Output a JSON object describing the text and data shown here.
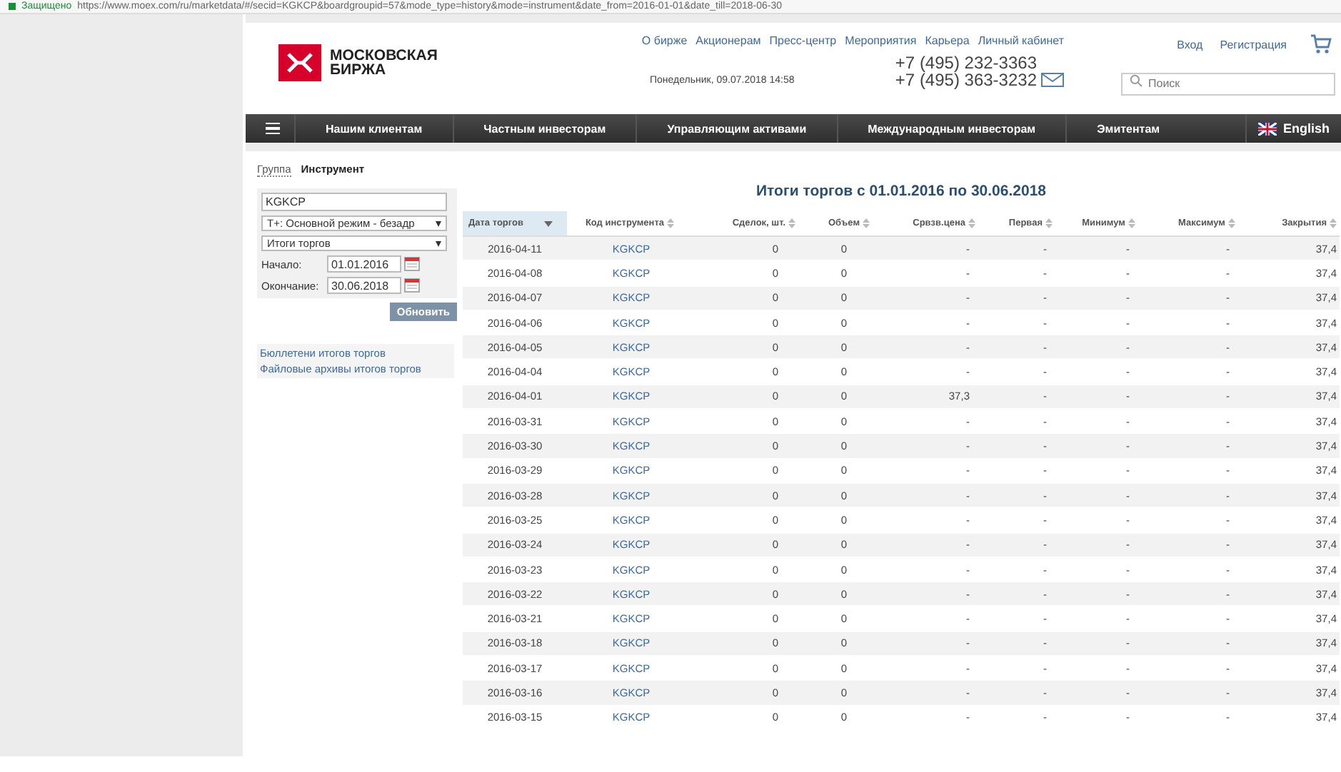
{
  "browser": {
    "secure_label": "Защищено",
    "url": "https://www.moex.com/ru/marketdata/#/secid=KGKCP&boardgroupid=57&mode_type=history&mode=instrument&date_from=2016-01-01&date_till=2018-06-30"
  },
  "header": {
    "logo_text": [
      "МОСКОВСКАЯ",
      "БИРЖА"
    ],
    "date": "Понедельник, 09.07.2018 14:58",
    "top_links": [
      "О бирже",
      "Акционерам",
      "Пресс-центр",
      "Мероприятия",
      "Карьера",
      "Личный кабинет"
    ],
    "phones": [
      "+7 (495) 232-3363",
      "+7 (495) 363-3232"
    ],
    "auth_links": [
      "Вход",
      "Регистрация"
    ],
    "search": {
      "placeholder": "Поиск"
    }
  },
  "nav": {
    "items": [
      "Нашим клиентам",
      "Частным инвесторам",
      "Управляющим активами",
      "Международным инвесторам",
      "Эмитентам"
    ],
    "language": "English"
  },
  "tabs": [
    {
      "label": "Группа",
      "selected": false
    },
    {
      "label": "Инструмент",
      "selected": true
    }
  ],
  "filters": {
    "instrument": "KGKCP",
    "board": "Т+: Основной режим - безадр",
    "report": "Итоги торгов",
    "start_label": "Начало:",
    "start": "01.01.2016",
    "end_label": "Окончание:",
    "end": "30.06.2018",
    "button": "Обновить"
  },
  "links": [
    "Бюллетени итогов торгов",
    "Файловые архивы итогов торгов"
  ],
  "table": {
    "title": "Итоги торгов с 01.01.2016 по 30.06.2018",
    "columns": [
      {
        "label": "Дата торгов",
        "sorted": true
      },
      {
        "label": "Код инструмента",
        "sorted": false
      },
      {
        "label": "Сделок, шт.",
        "sorted": false
      },
      {
        "label": "Объем",
        "sorted": false
      },
      {
        "label": "Срвзв.цена",
        "sorted": false
      },
      {
        "label": "Первая",
        "sorted": false
      },
      {
        "label": "Минимум",
        "sorted": false
      },
      {
        "label": "Максимум",
        "sorted": false
      },
      {
        "label": "Закрытия",
        "sorted": false
      }
    ],
    "rows": [
      [
        "2016-04-11",
        "KGKCP",
        "0",
        "0",
        "-",
        "-",
        "-",
        "-",
        "37,4"
      ],
      [
        "2016-04-08",
        "KGKCP",
        "0",
        "0",
        "-",
        "-",
        "-",
        "-",
        "37,4"
      ],
      [
        "2016-04-07",
        "KGKCP",
        "0",
        "0",
        "-",
        "-",
        "-",
        "-",
        "37,4"
      ],
      [
        "2016-04-06",
        "KGKCP",
        "0",
        "0",
        "-",
        "-",
        "-",
        "-",
        "37,4"
      ],
      [
        "2016-04-05",
        "KGKCP",
        "0",
        "0",
        "-",
        "-",
        "-",
        "-",
        "37,4"
      ],
      [
        "2016-04-04",
        "KGKCP",
        "0",
        "0",
        "-",
        "-",
        "-",
        "-",
        "37,4"
      ],
      [
        "2016-04-01",
        "KGKCP",
        "0",
        "0",
        "37,3",
        "-",
        "-",
        "-",
        "37,4"
      ],
      [
        "2016-03-31",
        "KGKCP",
        "0",
        "0",
        "-",
        "-",
        "-",
        "-",
        "37,4"
      ],
      [
        "2016-03-30",
        "KGKCP",
        "0",
        "0",
        "-",
        "-",
        "-",
        "-",
        "37,4"
      ],
      [
        "2016-03-29",
        "KGKCP",
        "0",
        "0",
        "-",
        "-",
        "-",
        "-",
        "37,4"
      ],
      [
        "2016-03-28",
        "KGKCP",
        "0",
        "0",
        "-",
        "-",
        "-",
        "-",
        "37,4"
      ],
      [
        "2016-03-25",
        "KGKCP",
        "0",
        "0",
        "-",
        "-",
        "-",
        "-",
        "37,4"
      ],
      [
        "2016-03-24",
        "KGKCP",
        "0",
        "0",
        "-",
        "-",
        "-",
        "-",
        "37,4"
      ],
      [
        "2016-03-23",
        "KGKCP",
        "0",
        "0",
        "-",
        "-",
        "-",
        "-",
        "37,4"
      ],
      [
        "2016-03-22",
        "KGKCP",
        "0",
        "0",
        "-",
        "-",
        "-",
        "-",
        "37,4"
      ],
      [
        "2016-03-21",
        "KGKCP",
        "0",
        "0",
        "-",
        "-",
        "-",
        "-",
        "37,4"
      ],
      [
        "2016-03-18",
        "KGKCP",
        "0",
        "0",
        "-",
        "-",
        "-",
        "-",
        "37,4"
      ],
      [
        "2016-03-17",
        "KGKCP",
        "0",
        "0",
        "-",
        "-",
        "-",
        "-",
        "37,4"
      ],
      [
        "2016-03-16",
        "KGKCP",
        "0",
        "0",
        "-",
        "-",
        "-",
        "-",
        "37,4"
      ],
      [
        "2016-03-15",
        "KGKCP",
        "0",
        "0",
        "-",
        "-",
        "-",
        "-",
        "37,4"
      ]
    ]
  }
}
